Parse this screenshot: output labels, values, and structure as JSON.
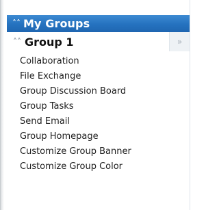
{
  "panel": {
    "title": "My Groups",
    "collapse_icon": "double-chevron-up-icon"
  },
  "group": {
    "title": "Group 1",
    "collapse_icon": "double-chevron-up-icon",
    "side_icon": "double-chevron-right-icon"
  },
  "links": [
    "Collaboration",
    "File Exchange",
    "Group Discussion Board",
    "Group Tasks",
    "Send Email",
    "Group Homepage",
    "Customize Group Banner",
    "Customize Group Color"
  ],
  "colors": {
    "header_bg": "#2572bf",
    "header_text": "#ffffff",
    "link_text": "#1e1e1e"
  }
}
